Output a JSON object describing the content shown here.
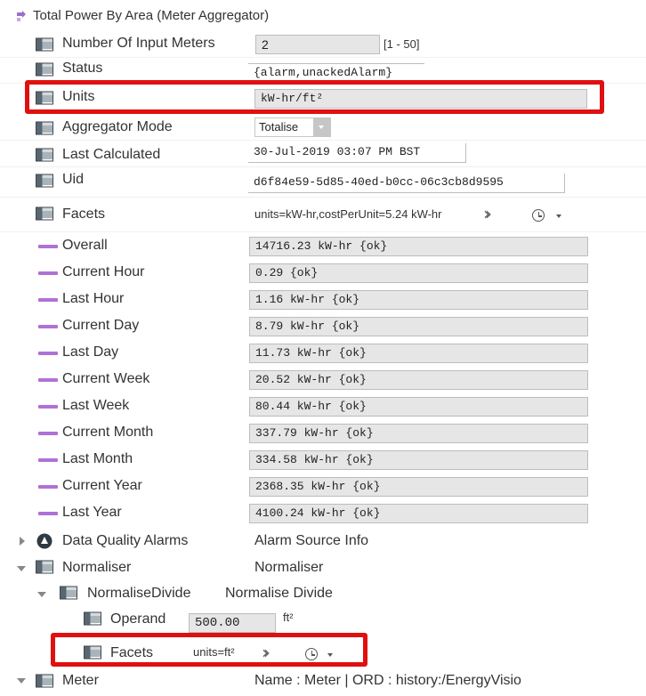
{
  "header": {
    "title": "Total Power By Area  (Meter Aggregator)"
  },
  "properties": {
    "num_input_meters": {
      "label": "Number Of Input Meters",
      "value": "2",
      "range": "[1 - 50]"
    },
    "status": {
      "label": "Status",
      "value": "{alarm,unackedAlarm}"
    },
    "units": {
      "label": "Units",
      "value": "kW-hr/ft²"
    },
    "aggregator_mode": {
      "label": "Aggregator Mode",
      "value": "Totalise"
    },
    "last_calculated": {
      "label": "Last Calculated",
      "value": "30-Jul-2019 03:07 PM BST"
    },
    "uid": {
      "label": "Uid",
      "value": "d6f84e59-5d85-40ed-b0cc-06c3cb8d9595"
    },
    "facets": {
      "label": "Facets",
      "value": "units=kW-hr,costPerUnit=5.24 kW-hr"
    }
  },
  "readings": [
    {
      "label": "Overall",
      "value": "14716.23 kW-hr {ok}"
    },
    {
      "label": "Current Hour",
      "value": "0.29 {ok}"
    },
    {
      "label": "Last Hour",
      "value": "1.16 kW-hr {ok}"
    },
    {
      "label": "Current Day",
      "value": "8.79 kW-hr {ok}"
    },
    {
      "label": "Last Day",
      "value": "11.73 kW-hr {ok}"
    },
    {
      "label": "Current Week",
      "value": "20.52 kW-hr {ok}"
    },
    {
      "label": "Last Week",
      "value": "80.44 kW-hr {ok}"
    },
    {
      "label": "Current Month",
      "value": "337.79 kW-hr {ok}"
    },
    {
      "label": "Last Month",
      "value": "334.58 kW-hr {ok}"
    },
    {
      "label": "Current Year",
      "value": "2368.35 kW-hr {ok}"
    },
    {
      "label": "Last Year",
      "value": "4100.24 kW-hr {ok}"
    }
  ],
  "tree": {
    "dq_alarms": {
      "label": "Data Quality Alarms",
      "value": "Alarm Source Info"
    },
    "normaliser": {
      "label": "Normaliser",
      "value": "Normaliser"
    },
    "normalise_divide": {
      "label": "NormaliseDivide",
      "value": "Normalise Divide"
    },
    "operand": {
      "label": "Operand",
      "value": "500.00",
      "unit": "ft²"
    },
    "norm_facets": {
      "label": "Facets",
      "value": "units=ft²"
    },
    "meter": {
      "label": "Meter",
      "value": "Name : Meter | ORD : history:/EnergyVisio"
    }
  },
  "colors": {
    "highlight": "#e01010",
    "reading_icon": "#b071d6"
  },
  "icons": {
    "property": "property-icon",
    "reading": "numeric-point-icon",
    "alarm": "alarm-icon",
    "folder": "component-icon",
    "history": "clock-icon",
    "chevron": "chevron-double-right-icon"
  }
}
